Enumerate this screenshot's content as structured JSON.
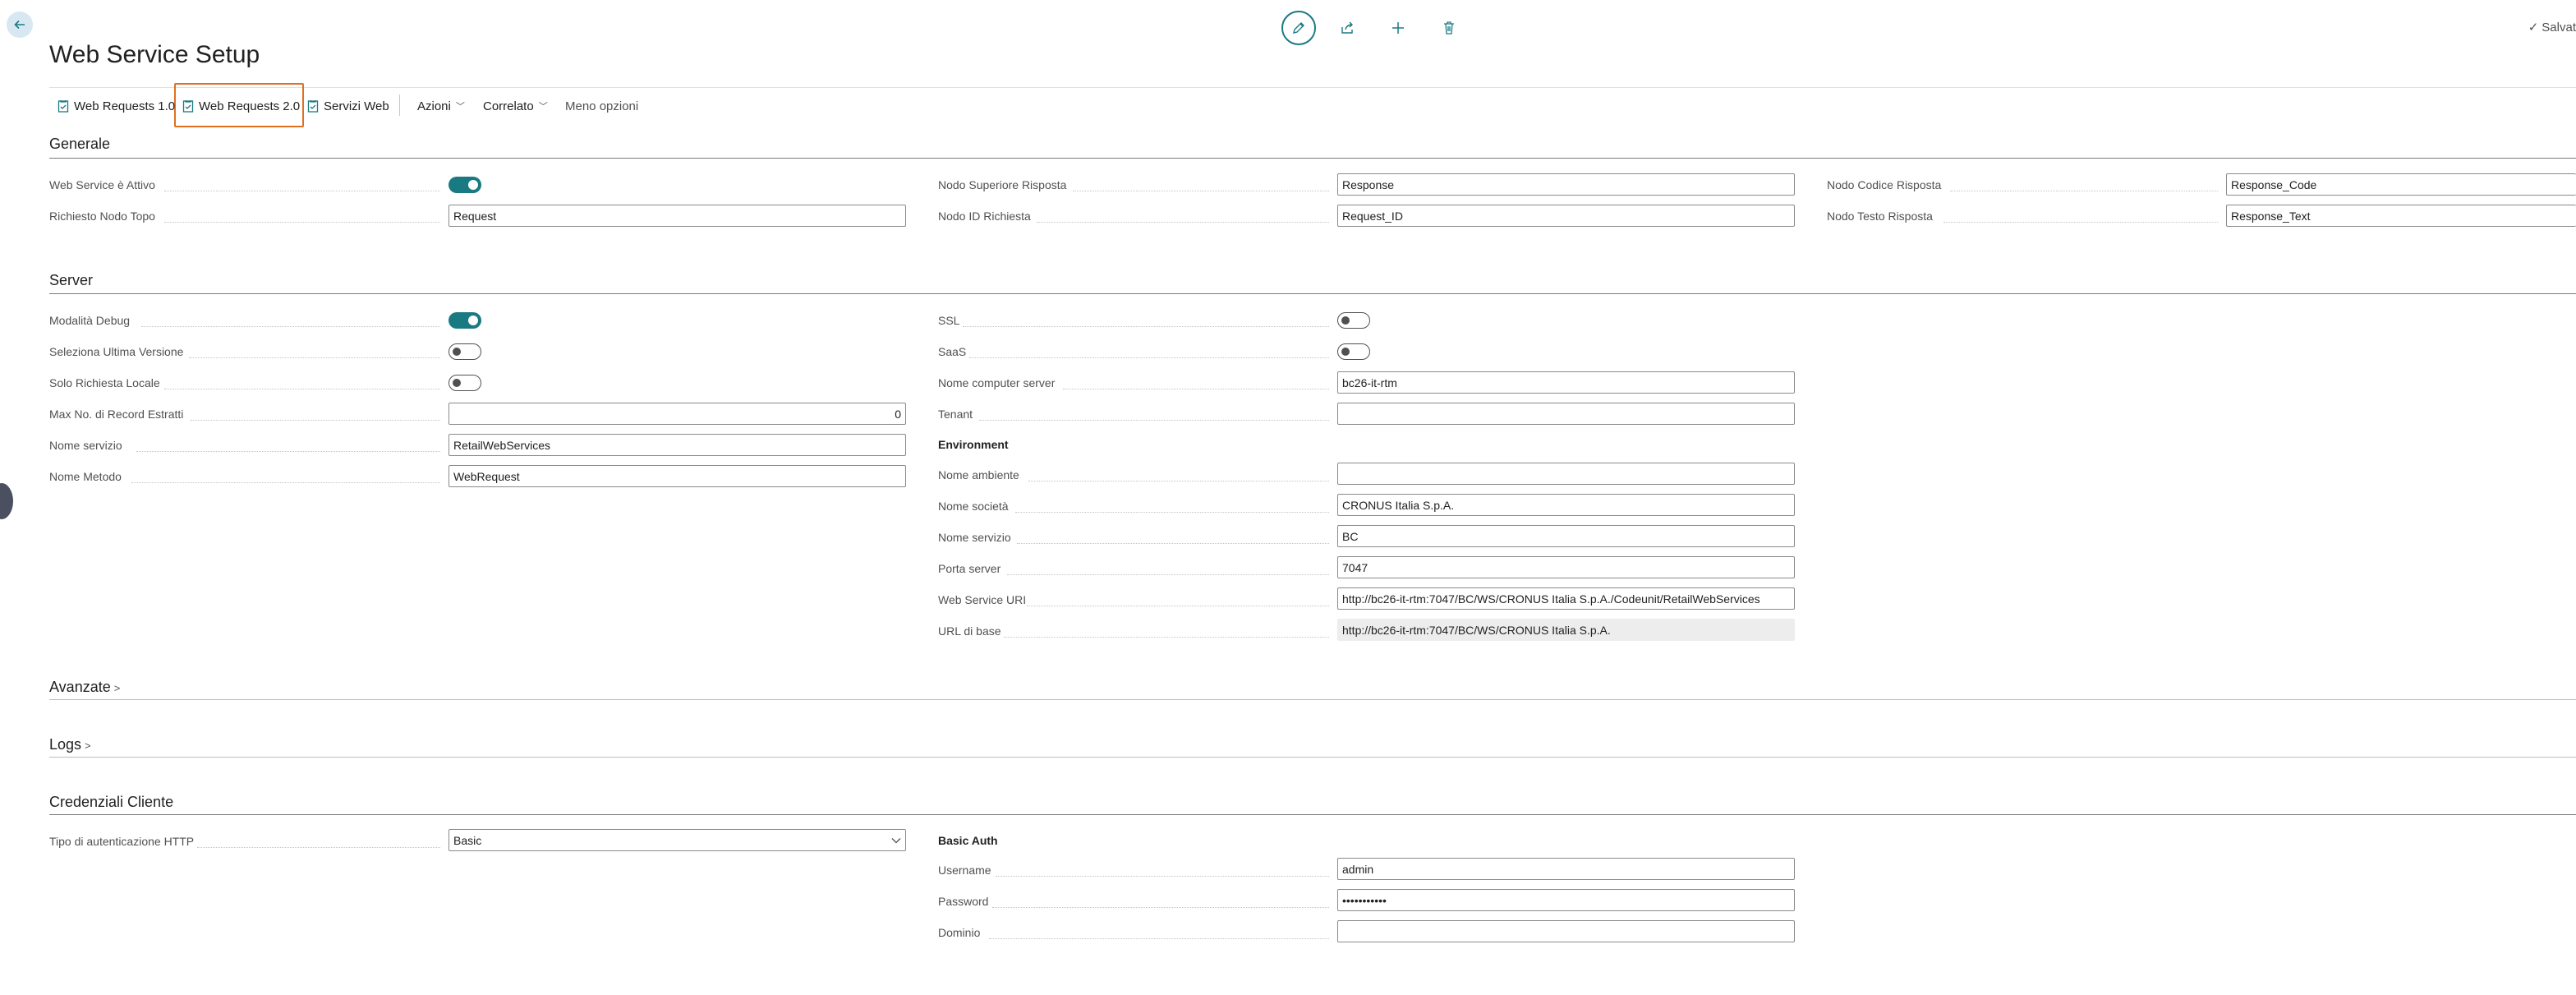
{
  "header": {
    "page_title": "Web Service Setup",
    "save_label": "Salvat"
  },
  "actions": {
    "web_requests_1": "Web Requests 1.0",
    "web_requests_2": "Web Requests 2.0",
    "servizi_web": "Servizi Web",
    "azioni": "Azioni",
    "correlato": "Correlato",
    "meno_opzioni": "Meno opzioni"
  },
  "generale": {
    "title": "Generale",
    "web_service_attivo_label": "Web Service è Attivo",
    "web_service_attivo": true,
    "richiesta_nodo_topo_label": "Richiesto Nodo Topo",
    "richiesta_nodo_topo": "Request",
    "nodo_superiore_risposta_label": "Nodo Superiore Risposta",
    "nodo_superiore_risposta": "Response",
    "nodo_id_richiesta_label": "Nodo ID Richiesta",
    "nodo_id_richiesta": "Request_ID",
    "nodo_codice_risposta_label": "Nodo Codice Risposta",
    "nodo_codice_risposta": "Response_Code",
    "nodo_testo_risposta_label": "Nodo Testo Risposta",
    "nodo_testo_risposta": "Response_Text"
  },
  "server": {
    "title": "Server",
    "modalita_debug_label": "Modalità Debug",
    "modalita_debug": true,
    "seleziona_ultima_versione_label": "Seleziona Ultima Versione",
    "seleziona_ultima_versione": false,
    "solo_richiesta_locale_label": "Solo Richiesta Locale",
    "solo_richiesta_locale": false,
    "max_record_label": "Max No. di Record Estratti",
    "max_record": "0",
    "nome_servizio_label": "Nome servizio",
    "nome_servizio": "RetailWebServices",
    "nome_metodo_label": "Nome Metodo",
    "nome_metodo": "WebRequest",
    "ssl_label": "SSL",
    "ssl": false,
    "saas_label": "SaaS",
    "saas": false,
    "nome_computer_server_label": "Nome computer server",
    "nome_computer_server": "bc26-it-rtm",
    "tenant_label": "Tenant",
    "tenant": "",
    "environment_heading": "Environment",
    "nome_ambiente_label": "Nome ambiente",
    "nome_ambiente": "",
    "nome_societa_label": "Nome società",
    "nome_societa": "CRONUS Italia S.p.A.",
    "env_nome_servizio_label": "Nome servizio",
    "env_nome_servizio": "BC",
    "porta_server_label": "Porta server",
    "porta_server": "7047",
    "web_service_uri_label": "Web Service URI",
    "web_service_uri": "http://bc26-it-rtm:7047/BC/WS/CRONUS Italia S.p.A./Codeunit/RetailWebServices",
    "url_di_base_label": "URL di base",
    "url_di_base": "http://bc26-it-rtm:7047/BC/WS/CRONUS Italia S.p.A."
  },
  "avanzate": {
    "title": "Avanzate"
  },
  "logs": {
    "title": "Logs"
  },
  "credenziali": {
    "title": "Credenziali Cliente",
    "tipo_autenticazione_label": "Tipo di autenticazione HTTP",
    "tipo_autenticazione": "Basic",
    "basic_auth_heading": "Basic Auth",
    "username_label": "Username",
    "username": "admin",
    "password_label": "Password",
    "password": "•••••••••••",
    "dominio_label": "Dominio",
    "dominio": ""
  },
  "colors": {
    "accent": "#1a7a82",
    "focus": "#e07020"
  }
}
